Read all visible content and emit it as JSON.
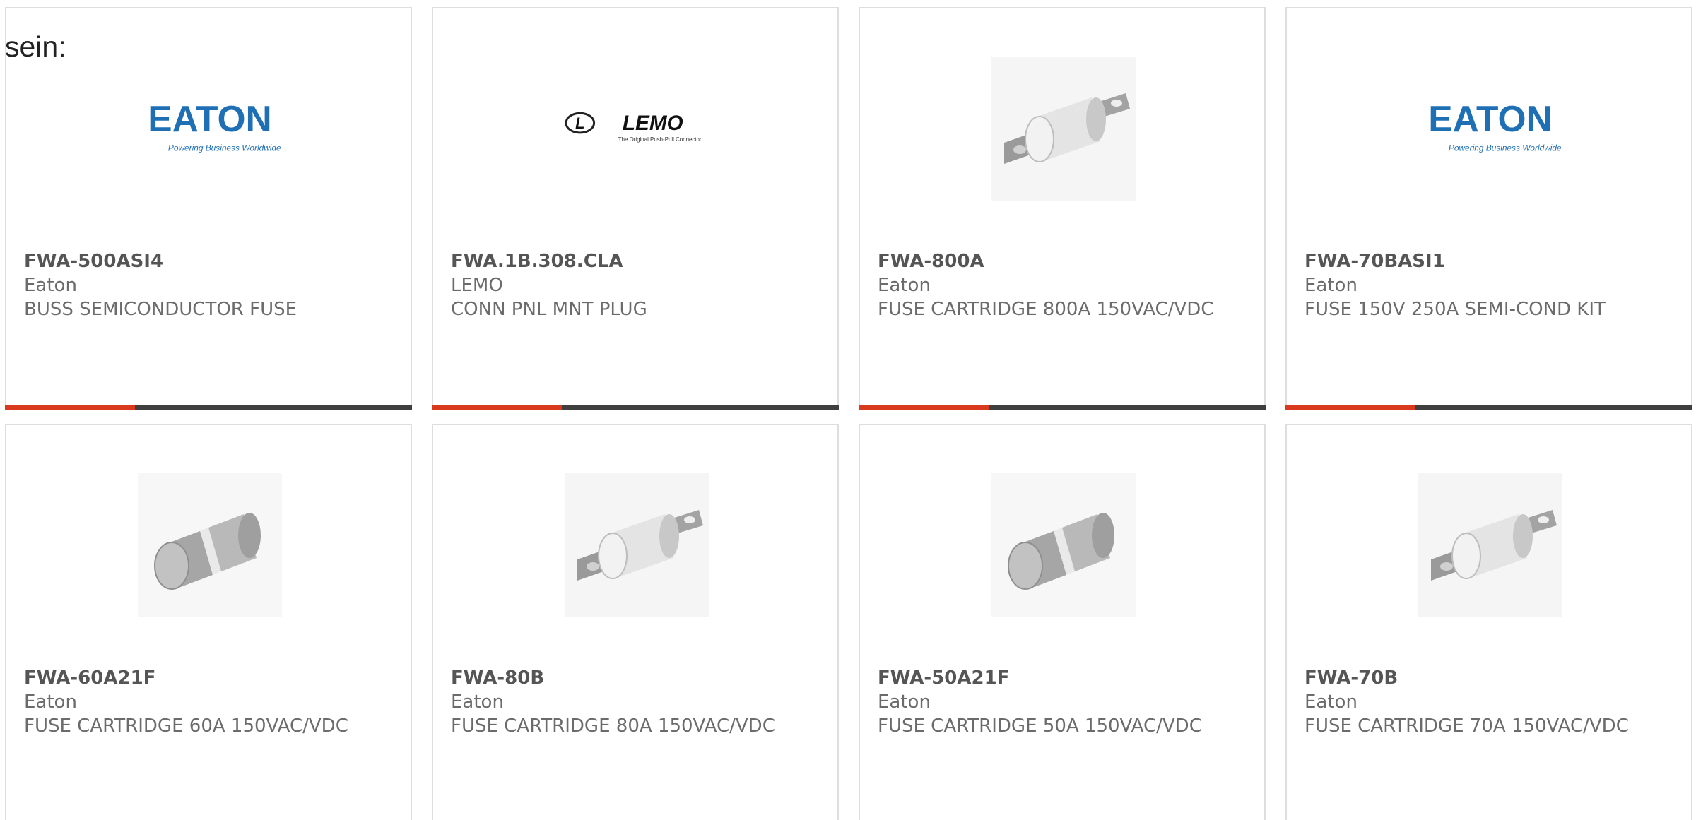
{
  "intro": {
    "text": "sein:"
  },
  "colors": {
    "accent": "#d9391c",
    "bar": "#3f3f3f",
    "eaton_blue": "#1f6fb5"
  },
  "cards": [
    {
      "part": "FWA-500ASI4",
      "manufacturer": "Eaton",
      "description": "BUSS SEMICONDUCTOR FUSE",
      "image": "eaton-logo",
      "logo": {
        "brand": "EATON",
        "tagline": "Powering Business Worldwide"
      }
    },
    {
      "part": "FWA.1B.308.CLA",
      "manufacturer": "LEMO",
      "description": "CONN PNL MNT PLUG",
      "image": "lemo-logo",
      "logo": {
        "brand": "LEMO",
        "tagline": "The Original Push-Pull Connector"
      }
    },
    {
      "part": "FWA-800A",
      "manufacturer": "Eaton",
      "description": "FUSE CARTRIDGE 800A 150VAC/VDC",
      "image": "tab-fuse-photo"
    },
    {
      "part": "FWA-70BASI1",
      "manufacturer": "Eaton",
      "description": "FUSE 150V 250A SEMI-COND KIT",
      "image": "eaton-logo",
      "logo": {
        "brand": "EATON",
        "tagline": "Powering Business Worldwide"
      }
    },
    {
      "part": "FWA-60A21F",
      "manufacturer": "Eaton",
      "description": "FUSE CARTRIDGE 60A 150VAC/VDC",
      "image": "cartridge-fuse-photo"
    },
    {
      "part": "FWA-80B",
      "manufacturer": "Eaton",
      "description": "FUSE CARTRIDGE 80A 150VAC/VDC",
      "image": "tab-fuse-photo"
    },
    {
      "part": "FWA-50A21F",
      "manufacturer": "Eaton",
      "description": "FUSE CARTRIDGE 50A 150VAC/VDC",
      "image": "cartridge-fuse-photo"
    },
    {
      "part": "FWA-70B",
      "manufacturer": "Eaton",
      "description": "FUSE CARTRIDGE 70A 150VAC/VDC",
      "image": "tab-fuse-photo"
    }
  ]
}
